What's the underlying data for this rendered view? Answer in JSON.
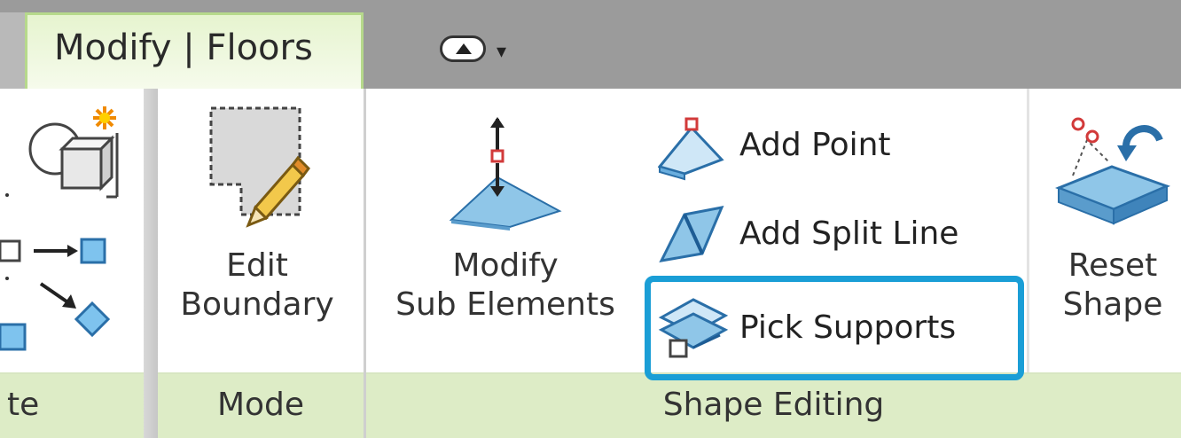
{
  "tab": {
    "label": "Modify | Floors"
  },
  "panels": {
    "partial": {
      "footer": "te"
    },
    "mode": {
      "command_line1": "Edit",
      "command_line2": "Boundary",
      "footer": "Mode"
    },
    "shape_editing": {
      "modify_line1": "Modify",
      "modify_line2": "Sub Elements",
      "add_point": "Add Point",
      "add_split_line": "Add Split Line",
      "pick_supports": "Pick Supports",
      "reset_line1": "Reset",
      "reset_line2": "Shape",
      "footer": "Shape Editing"
    }
  },
  "colors": {
    "highlight": "#1a9ed6",
    "footer_bg": "#ddecc6",
    "tab_bg": "#e6f4cf"
  }
}
